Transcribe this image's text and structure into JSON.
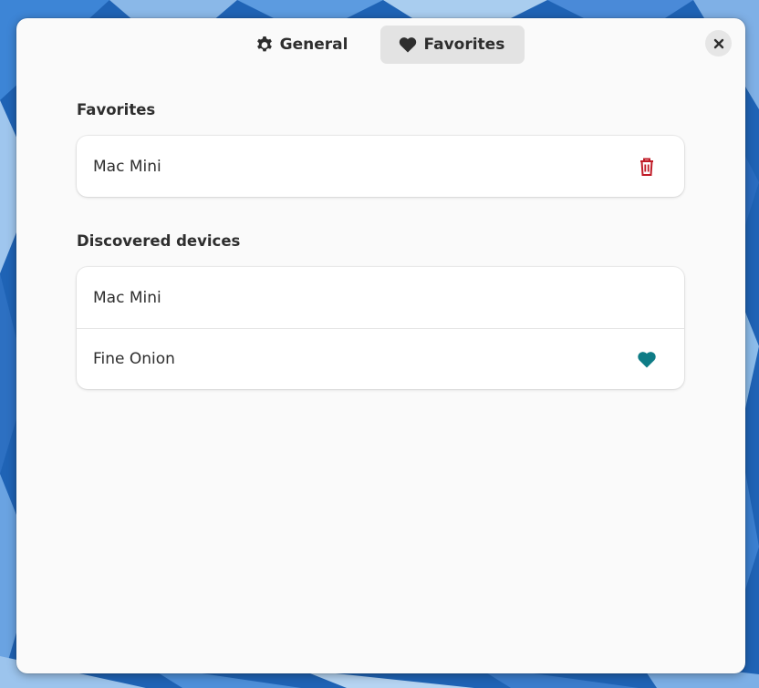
{
  "window": {
    "close_icon": "close-icon"
  },
  "tabs": [
    {
      "label": "General",
      "icon": "gear-icon",
      "active": false
    },
    {
      "label": "Favorites",
      "icon": "heart-icon",
      "active": true
    }
  ],
  "favorites": {
    "title": "Favorites",
    "items": [
      {
        "label": "Mac Mini",
        "action_icon": "trash-icon"
      }
    ]
  },
  "discovered": {
    "title": "Discovered devices",
    "items": [
      {
        "label": "Mac Mini",
        "action_icon": ""
      },
      {
        "label": "Fine Onion",
        "action_icon": "heart-icon"
      }
    ]
  },
  "colors": {
    "trash": "#c01c28",
    "heart_accent": "#0e7c86",
    "dialog_bg": "#fafafa",
    "active_tab_bg": "#e3e3e3"
  }
}
